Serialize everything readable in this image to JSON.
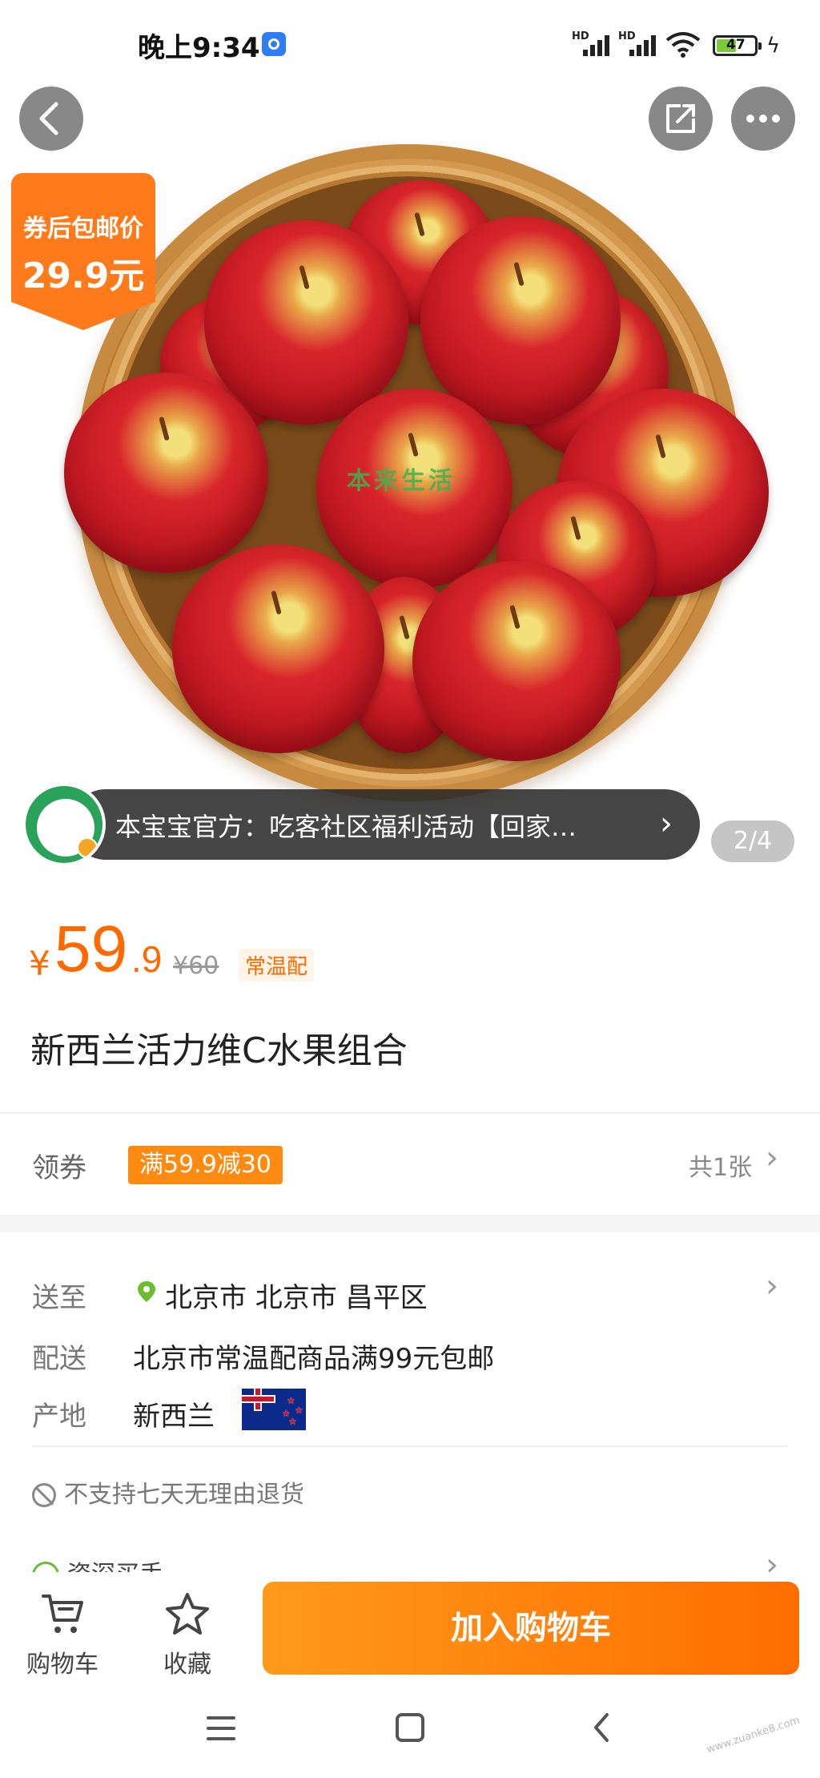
{
  "status_bar": {
    "time": "晚上9:34",
    "signal_label_1": "HD",
    "signal_label_2": "HD",
    "battery": "47"
  },
  "hero": {
    "promo_tag_line1": "券后包邮价",
    "promo_tag_line2": "29.9元",
    "image_watermark": "本来生活",
    "notice_text": "本宝宝官方：吃客社区福利活动【回家…",
    "page_indicator": "2/4"
  },
  "price": {
    "currency": "¥",
    "integer": "59",
    "decimal": ".9",
    "original": "¥60",
    "tag": "常温配"
  },
  "product": {
    "title": "新西兰活力维C水果组合"
  },
  "coupon": {
    "label": "领券",
    "offer": "满59.9减30",
    "count": "共1张"
  },
  "delivery": {
    "ship_to_label": "送至",
    "ship_to_value": "北京市 北京市 昌平区",
    "delivery_label": "配送",
    "delivery_value": "北京市常温配商品满99元包邮",
    "origin_label": "产地",
    "origin_value": "新西兰"
  },
  "policy": {
    "no_refund": "不支持七天无理由退货",
    "buyer": "资深买手"
  },
  "action_bar": {
    "cart": "购物车",
    "favorite": "收藏",
    "add_to_cart": "加入购物车"
  },
  "watermark": "www.zuanke8.com"
}
